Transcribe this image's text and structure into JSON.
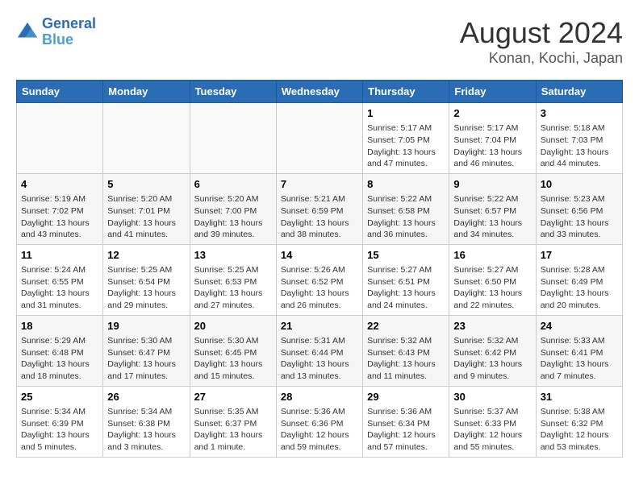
{
  "header": {
    "logo_line1": "General",
    "logo_line2": "Blue",
    "month_year": "August 2024",
    "location": "Konan, Kochi, Japan"
  },
  "days_of_week": [
    "Sunday",
    "Monday",
    "Tuesday",
    "Wednesday",
    "Thursday",
    "Friday",
    "Saturday"
  ],
  "weeks": [
    [
      {
        "num": "",
        "info": ""
      },
      {
        "num": "",
        "info": ""
      },
      {
        "num": "",
        "info": ""
      },
      {
        "num": "",
        "info": ""
      },
      {
        "num": "1",
        "info": "Sunrise: 5:17 AM\nSunset: 7:05 PM\nDaylight: 13 hours\nand 47 minutes."
      },
      {
        "num": "2",
        "info": "Sunrise: 5:17 AM\nSunset: 7:04 PM\nDaylight: 13 hours\nand 46 minutes."
      },
      {
        "num": "3",
        "info": "Sunrise: 5:18 AM\nSunset: 7:03 PM\nDaylight: 13 hours\nand 44 minutes."
      }
    ],
    [
      {
        "num": "4",
        "info": "Sunrise: 5:19 AM\nSunset: 7:02 PM\nDaylight: 13 hours\nand 43 minutes."
      },
      {
        "num": "5",
        "info": "Sunrise: 5:20 AM\nSunset: 7:01 PM\nDaylight: 13 hours\nand 41 minutes."
      },
      {
        "num": "6",
        "info": "Sunrise: 5:20 AM\nSunset: 7:00 PM\nDaylight: 13 hours\nand 39 minutes."
      },
      {
        "num": "7",
        "info": "Sunrise: 5:21 AM\nSunset: 6:59 PM\nDaylight: 13 hours\nand 38 minutes."
      },
      {
        "num": "8",
        "info": "Sunrise: 5:22 AM\nSunset: 6:58 PM\nDaylight: 13 hours\nand 36 minutes."
      },
      {
        "num": "9",
        "info": "Sunrise: 5:22 AM\nSunset: 6:57 PM\nDaylight: 13 hours\nand 34 minutes."
      },
      {
        "num": "10",
        "info": "Sunrise: 5:23 AM\nSunset: 6:56 PM\nDaylight: 13 hours\nand 33 minutes."
      }
    ],
    [
      {
        "num": "11",
        "info": "Sunrise: 5:24 AM\nSunset: 6:55 PM\nDaylight: 13 hours\nand 31 minutes."
      },
      {
        "num": "12",
        "info": "Sunrise: 5:25 AM\nSunset: 6:54 PM\nDaylight: 13 hours\nand 29 minutes."
      },
      {
        "num": "13",
        "info": "Sunrise: 5:25 AM\nSunset: 6:53 PM\nDaylight: 13 hours\nand 27 minutes."
      },
      {
        "num": "14",
        "info": "Sunrise: 5:26 AM\nSunset: 6:52 PM\nDaylight: 13 hours\nand 26 minutes."
      },
      {
        "num": "15",
        "info": "Sunrise: 5:27 AM\nSunset: 6:51 PM\nDaylight: 13 hours\nand 24 minutes."
      },
      {
        "num": "16",
        "info": "Sunrise: 5:27 AM\nSunset: 6:50 PM\nDaylight: 13 hours\nand 22 minutes."
      },
      {
        "num": "17",
        "info": "Sunrise: 5:28 AM\nSunset: 6:49 PM\nDaylight: 13 hours\nand 20 minutes."
      }
    ],
    [
      {
        "num": "18",
        "info": "Sunrise: 5:29 AM\nSunset: 6:48 PM\nDaylight: 13 hours\nand 18 minutes."
      },
      {
        "num": "19",
        "info": "Sunrise: 5:30 AM\nSunset: 6:47 PM\nDaylight: 13 hours\nand 17 minutes."
      },
      {
        "num": "20",
        "info": "Sunrise: 5:30 AM\nSunset: 6:45 PM\nDaylight: 13 hours\nand 15 minutes."
      },
      {
        "num": "21",
        "info": "Sunrise: 5:31 AM\nSunset: 6:44 PM\nDaylight: 13 hours\nand 13 minutes."
      },
      {
        "num": "22",
        "info": "Sunrise: 5:32 AM\nSunset: 6:43 PM\nDaylight: 13 hours\nand 11 minutes."
      },
      {
        "num": "23",
        "info": "Sunrise: 5:32 AM\nSunset: 6:42 PM\nDaylight: 13 hours\nand 9 minutes."
      },
      {
        "num": "24",
        "info": "Sunrise: 5:33 AM\nSunset: 6:41 PM\nDaylight: 13 hours\nand 7 minutes."
      }
    ],
    [
      {
        "num": "25",
        "info": "Sunrise: 5:34 AM\nSunset: 6:39 PM\nDaylight: 13 hours\nand 5 minutes."
      },
      {
        "num": "26",
        "info": "Sunrise: 5:34 AM\nSunset: 6:38 PM\nDaylight: 13 hours\nand 3 minutes."
      },
      {
        "num": "27",
        "info": "Sunrise: 5:35 AM\nSunset: 6:37 PM\nDaylight: 13 hours\nand 1 minute."
      },
      {
        "num": "28",
        "info": "Sunrise: 5:36 AM\nSunset: 6:36 PM\nDaylight: 12 hours\nand 59 minutes."
      },
      {
        "num": "29",
        "info": "Sunrise: 5:36 AM\nSunset: 6:34 PM\nDaylight: 12 hours\nand 57 minutes."
      },
      {
        "num": "30",
        "info": "Sunrise: 5:37 AM\nSunset: 6:33 PM\nDaylight: 12 hours\nand 55 minutes."
      },
      {
        "num": "31",
        "info": "Sunrise: 5:38 AM\nSunset: 6:32 PM\nDaylight: 12 hours\nand 53 minutes."
      }
    ]
  ]
}
